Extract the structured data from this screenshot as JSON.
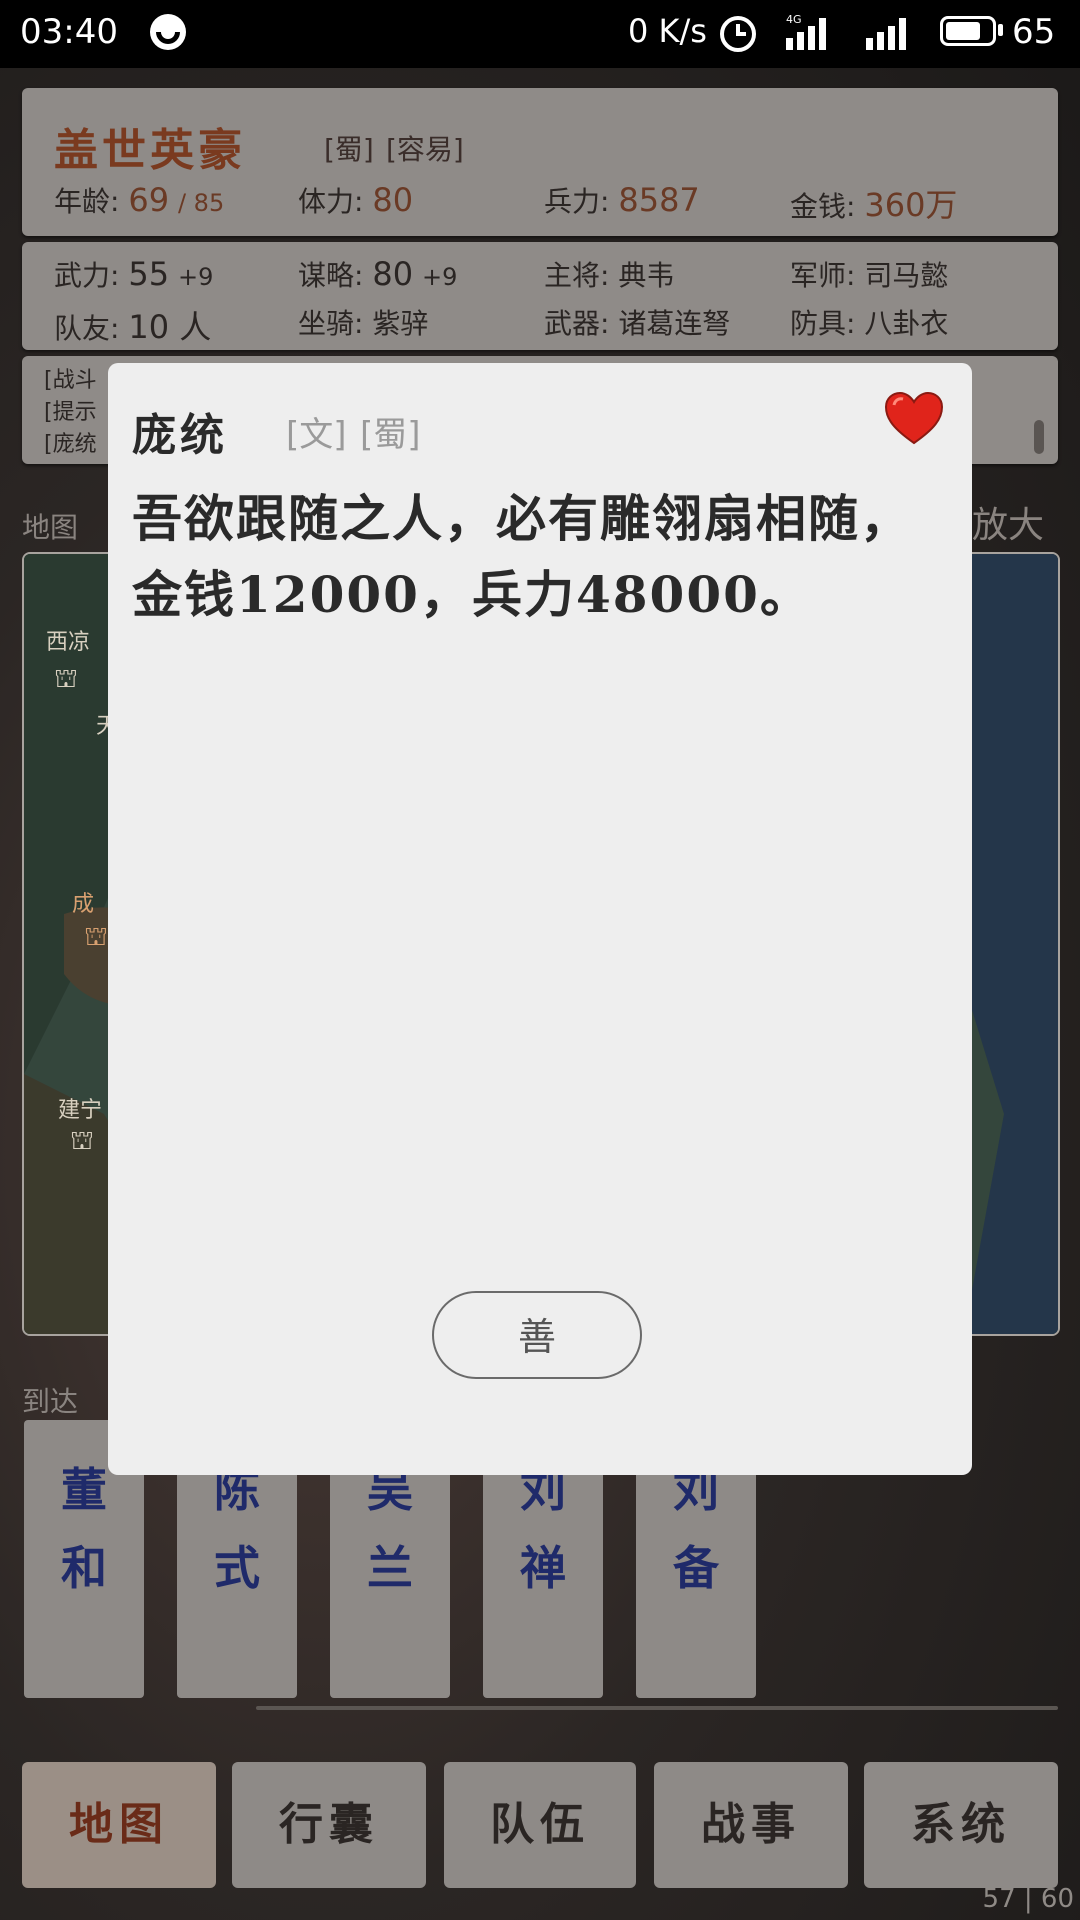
{
  "status_bar": {
    "time": "03:40",
    "net_speed": "0 K/s",
    "network": "4G",
    "battery": "65"
  },
  "player": {
    "title": "盖世英豪",
    "tags": [
      "[蜀]",
      "[容易]"
    ],
    "age_label": "年龄:",
    "age": "69",
    "age_max": "/ 85",
    "stamina_label": "体力:",
    "stamina": "80",
    "troops_label": "兵力:",
    "troops": "8587",
    "money_label": "金钱:",
    "money": "360万",
    "force_label": "武力:",
    "force": "55",
    "force_bonus": "+9",
    "strategy_label": "谋略:",
    "strategy": "80",
    "strategy_bonus": "+9",
    "general_label": "主将:",
    "general": "典韦",
    "advisor_label": "军师:",
    "advisor": "司马懿",
    "teammates_label": "队友:",
    "teammates": "10 人",
    "mount_label": "坐骑:",
    "mount": "紫骍",
    "weapon_label": "武器:",
    "weapon": "诸葛连弩",
    "armor_label": "防具:",
    "armor": "八卦衣"
  },
  "log": [
    "[战斗",
    "[提示",
    "[庞统"
  ],
  "map": {
    "label": "地图",
    "zoom_label": "放大",
    "cities": [
      "西凉",
      "天",
      "成",
      "建宁"
    ]
  },
  "arrived": {
    "label": "到达",
    "people": [
      {
        "line1": "董",
        "line2": "和"
      },
      {
        "line1": "陈",
        "line2": "式"
      },
      {
        "line1": "吴",
        "line2": "兰"
      },
      {
        "line1": "刘",
        "line2": "禅"
      },
      {
        "line1": "刘",
        "line2": "备"
      }
    ]
  },
  "nav": [
    "地图",
    "行囊",
    "队伍",
    "战事",
    "系统"
  ],
  "pager": "57 | 60",
  "dialog": {
    "name": "庞统",
    "tag1": "[文]",
    "tag2": "[蜀]",
    "message": "吾欲跟随之人，必有雕翎扇相随，金钱12000，兵力48000。",
    "button": "善"
  },
  "colors": {
    "heart": "#e0241b",
    "accent_title": "#7a3a1f",
    "card_name": "#1f2a6a"
  }
}
